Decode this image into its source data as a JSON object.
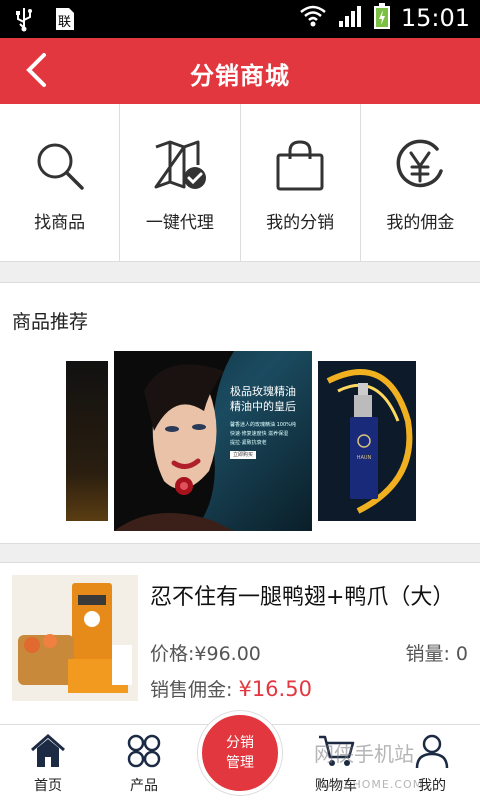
{
  "status_bar": {
    "time": "15:01"
  },
  "header": {
    "title": "分销商城"
  },
  "quick_menu": [
    {
      "label": "找商品",
      "icon": "search-icon"
    },
    {
      "label": "一键代理",
      "icon": "map-check-icon"
    },
    {
      "label": "我的分销",
      "icon": "shopping-bag-icon"
    },
    {
      "label": "我的佣金",
      "icon": "yen-coin-icon"
    }
  ],
  "recommend": {
    "title": "商品推荐",
    "banner_headline": "极品玫瑰精油",
    "banner_subline": "精油中的皇后",
    "banner_small_1": "馨香迷人的玫瑰精油 100%纯",
    "banner_small_2": "快速·修复速度快 滋养保湿",
    "banner_small_3": "提拉·紧致抗衰老",
    "banner_button": "立即购买",
    "bottle_brand": "HAUN"
  },
  "product": {
    "name": "忍不住有一腿鸭翅+鸭爪（大）",
    "price_label": "价格:",
    "price": "¥96.00",
    "sales_label": "销量:",
    "sales": "0",
    "commission_label": "销售佣金:",
    "commission": "¥16.50"
  },
  "bottom_nav": {
    "home": "首页",
    "products": "产品",
    "center_line1": "分销",
    "center_line2": "管理",
    "cart": "购物车",
    "mine": "我的"
  },
  "watermark": {
    "text": "网侠手机站",
    "url": "HACKHOME.COM"
  },
  "colors": {
    "accent": "#e3373f",
    "status_bar": "#000000"
  }
}
